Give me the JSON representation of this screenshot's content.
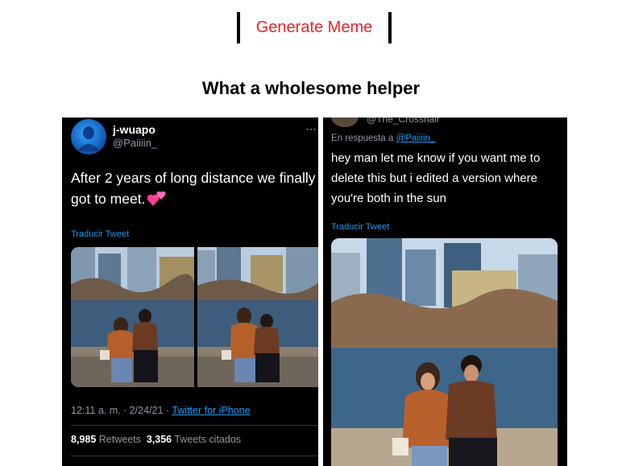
{
  "toolbar": {
    "generate_label": "Generate Meme"
  },
  "meme": {
    "title": "What a wholesome helper",
    "left_tweet": {
      "name": "j-wuapo",
      "handle": "@Paiiiin_",
      "more": "···",
      "text_line1": "After 2 years of long distance we finally",
      "text_line2": "got to meet.",
      "translate": "Traducir Tweet",
      "time_date": "12:11 a. m. · 2/24/21 · ",
      "source": "Twitter for iPhone",
      "retweets_count": "8,985",
      "retweets_label": "Retweets",
      "quotes_count": "3,356",
      "quotes_label": "Tweets citados"
    },
    "right_tweet": {
      "handle": "@The_Crosshair",
      "reply_prefix": "En respuesta a ",
      "reply_mention": "@Paiiiin_",
      "text": "hey man let me know if you want me to delete this but i edited a version where you're both in the sun",
      "translate": "Traducir Tweet"
    }
  },
  "colors": {
    "accent_red": "#e6252b",
    "tweet_bg": "#000000",
    "link_blue": "#1d9bf0",
    "muted": "#8b98a5"
  }
}
